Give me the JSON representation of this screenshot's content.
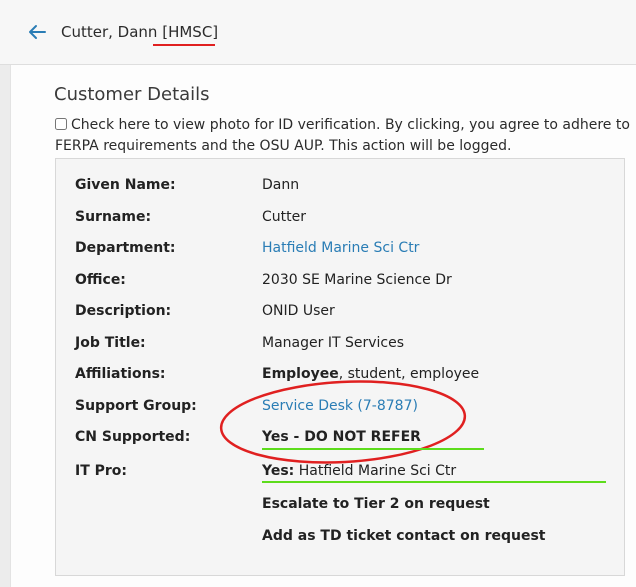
{
  "header": {
    "name": "Cutter, Dann",
    "tag": "[HMSC]"
  },
  "section": {
    "title": "Customer Details",
    "consent_text": "Check here to view photo for ID verification. By clicking, you agree to adhere to FERPA requirements and the OSU AUP. This action will be logged."
  },
  "details": {
    "given_name": {
      "label": "Given Name:",
      "value": "Dann"
    },
    "surname": {
      "label": "Surname:",
      "value": "Cutter"
    },
    "department": {
      "label": "Department:",
      "value": "Hatfield Marine Sci Ctr"
    },
    "office": {
      "label": "Office:",
      "value": "2030 SE Marine Science Dr"
    },
    "description": {
      "label": "Description:",
      "value": "ONID User"
    },
    "job_title": {
      "label": "Job Title:",
      "value": "Manager IT Services"
    },
    "affiliations": {
      "label": "Affiliations:",
      "primary": "Employee",
      "rest": ", student, employee"
    },
    "support_group": {
      "label": "Support Group:",
      "value": "Service Desk (7-8787)"
    },
    "cn_supported": {
      "label": "CN Supported:",
      "value": "Yes - DO NOT REFER"
    },
    "it_pro": {
      "label": "IT Pro:",
      "yes": "Yes:",
      "value": " Hatfield Marine Sci Ctr",
      "line2": "Escalate to Tier 2 on request",
      "line3": "Add as TD ticket contact on request"
    }
  },
  "colors": {
    "link": "#2a7db5",
    "annotation_red": "#e02020",
    "annotation_green": "#5ddc1c"
  }
}
